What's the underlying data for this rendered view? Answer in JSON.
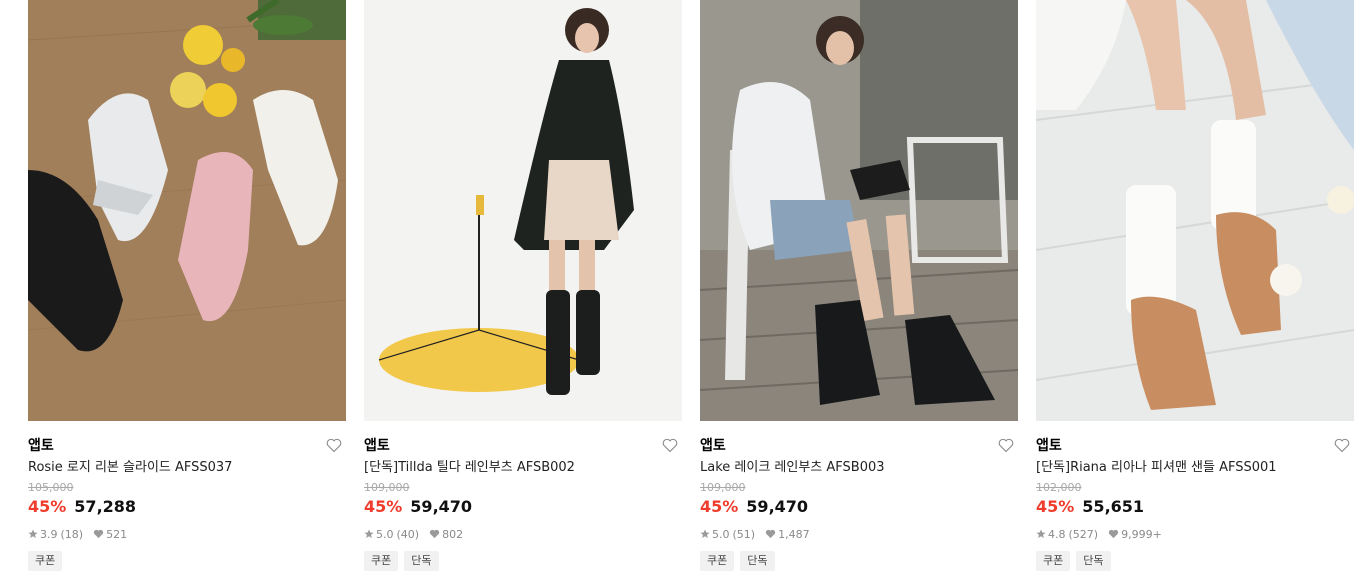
{
  "products": [
    {
      "brand": "앱토",
      "name": "Rosie 로지 리본 슬라이드 AFSS037",
      "original_price": "105,000",
      "discount": "45%",
      "price": "57,288",
      "rating": "3.9",
      "reviews": "(18)",
      "likes": "521",
      "tags": [
        "쿠폰"
      ]
    },
    {
      "brand": "앱토",
      "name": "[단독]Tillda 틸다 레인부츠 AFSB002",
      "original_price": "109,000",
      "discount": "45%",
      "price": "59,470",
      "rating": "5.0",
      "reviews": "(40)",
      "likes": "802",
      "tags": [
        "쿠폰",
        "단독"
      ]
    },
    {
      "brand": "앱토",
      "name": "Lake 레이크 레인부츠 AFSB003",
      "original_price": "109,000",
      "discount": "45%",
      "price": "59,470",
      "rating": "5.0",
      "reviews": "(51)",
      "likes": "1,487",
      "tags": [
        "쿠폰",
        "단독"
      ]
    },
    {
      "brand": "앱토",
      "name": "[단독]Riana 리아나 피셔맨 샌들 AFSS001",
      "original_price": "102,000",
      "discount": "45%",
      "price": "55,651",
      "rating": "4.8",
      "reviews": "(527)",
      "likes": "9,999+",
      "tags": [
        "쿠폰",
        "단독"
      ]
    }
  ],
  "colors": {
    "discount": "#f03c2c",
    "strike": "#a8a8a8",
    "meta": "#8a8a8a",
    "tag_bg": "#f1f1f1"
  },
  "icons": {
    "wishlist": "heart-outline-icon",
    "rating": "star-icon",
    "likes": "heart-filled-icon"
  }
}
